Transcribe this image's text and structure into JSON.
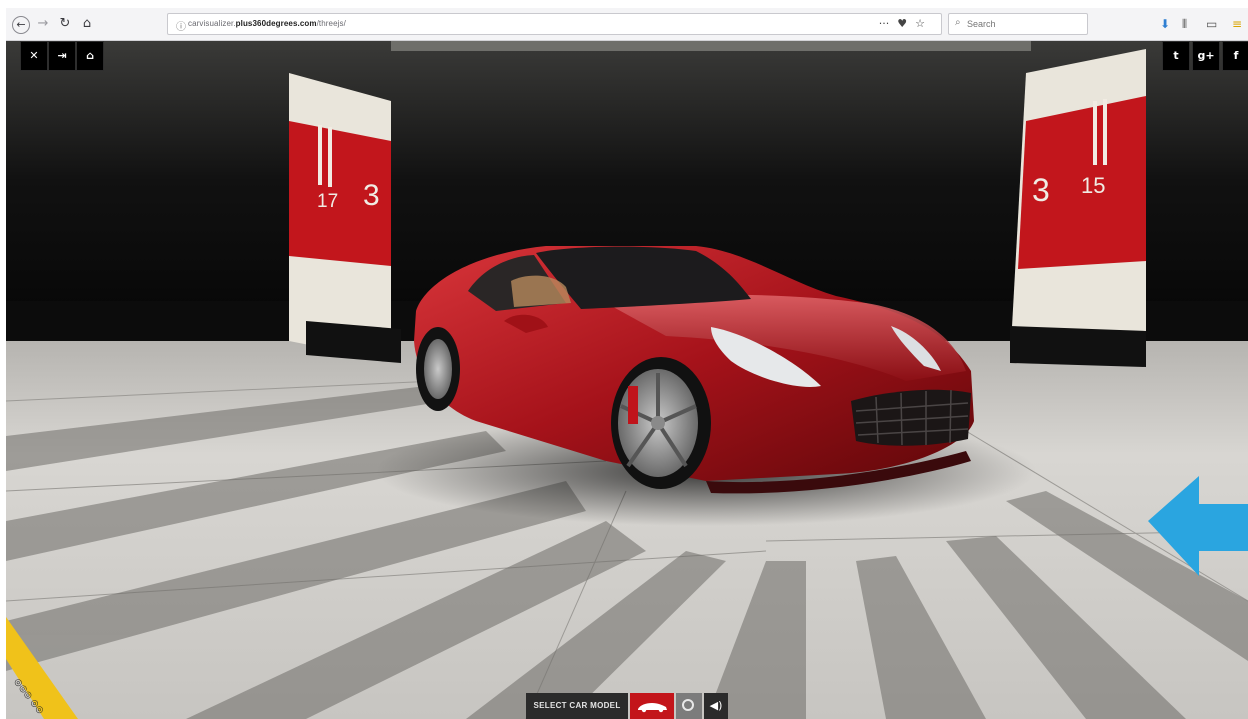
{
  "browser": {
    "back_glyph": "←",
    "forward_glyph": "→",
    "reload_glyph": "↻",
    "home_glyph": "⌂",
    "url_prefix": "carvisualizer.",
    "url_host": "plus360degrees.com",
    "url_path": "/threejs/",
    "page_actions": [
      "···",
      "♥",
      "☆"
    ],
    "search_placeholder": "Search",
    "download_glyph": "⬇",
    "library_glyph": "⫴",
    "reader_glyph": "▭",
    "menu_glyph": "≡"
  },
  "scene": {
    "left_controls": [
      {
        "name": "fullscreen-button",
        "glyph": "✕"
      },
      {
        "name": "controls-button",
        "glyph": "⇥"
      },
      {
        "name": "home-button",
        "glyph": "⌂"
      }
    ],
    "share_buttons": [
      {
        "name": "twitter-share-button",
        "glyph": "t"
      },
      {
        "name": "google-plus-share-button",
        "glyph": "g+"
      },
      {
        "name": "facebook-share-button",
        "glyph": "f"
      }
    ],
    "pillar_left": {
      "numbers": [
        "17",
        "3"
      ]
    },
    "pillar_right": {
      "numbers": [
        "3",
        "15"
      ]
    },
    "car_color": "#b5151d",
    "arrow_color": "#2aa5e0"
  },
  "bottom_bar": {
    "select_label": "SELECT CAR MODEL",
    "swatch_color": "#c3151a",
    "sound_glyph": "◀)"
  }
}
